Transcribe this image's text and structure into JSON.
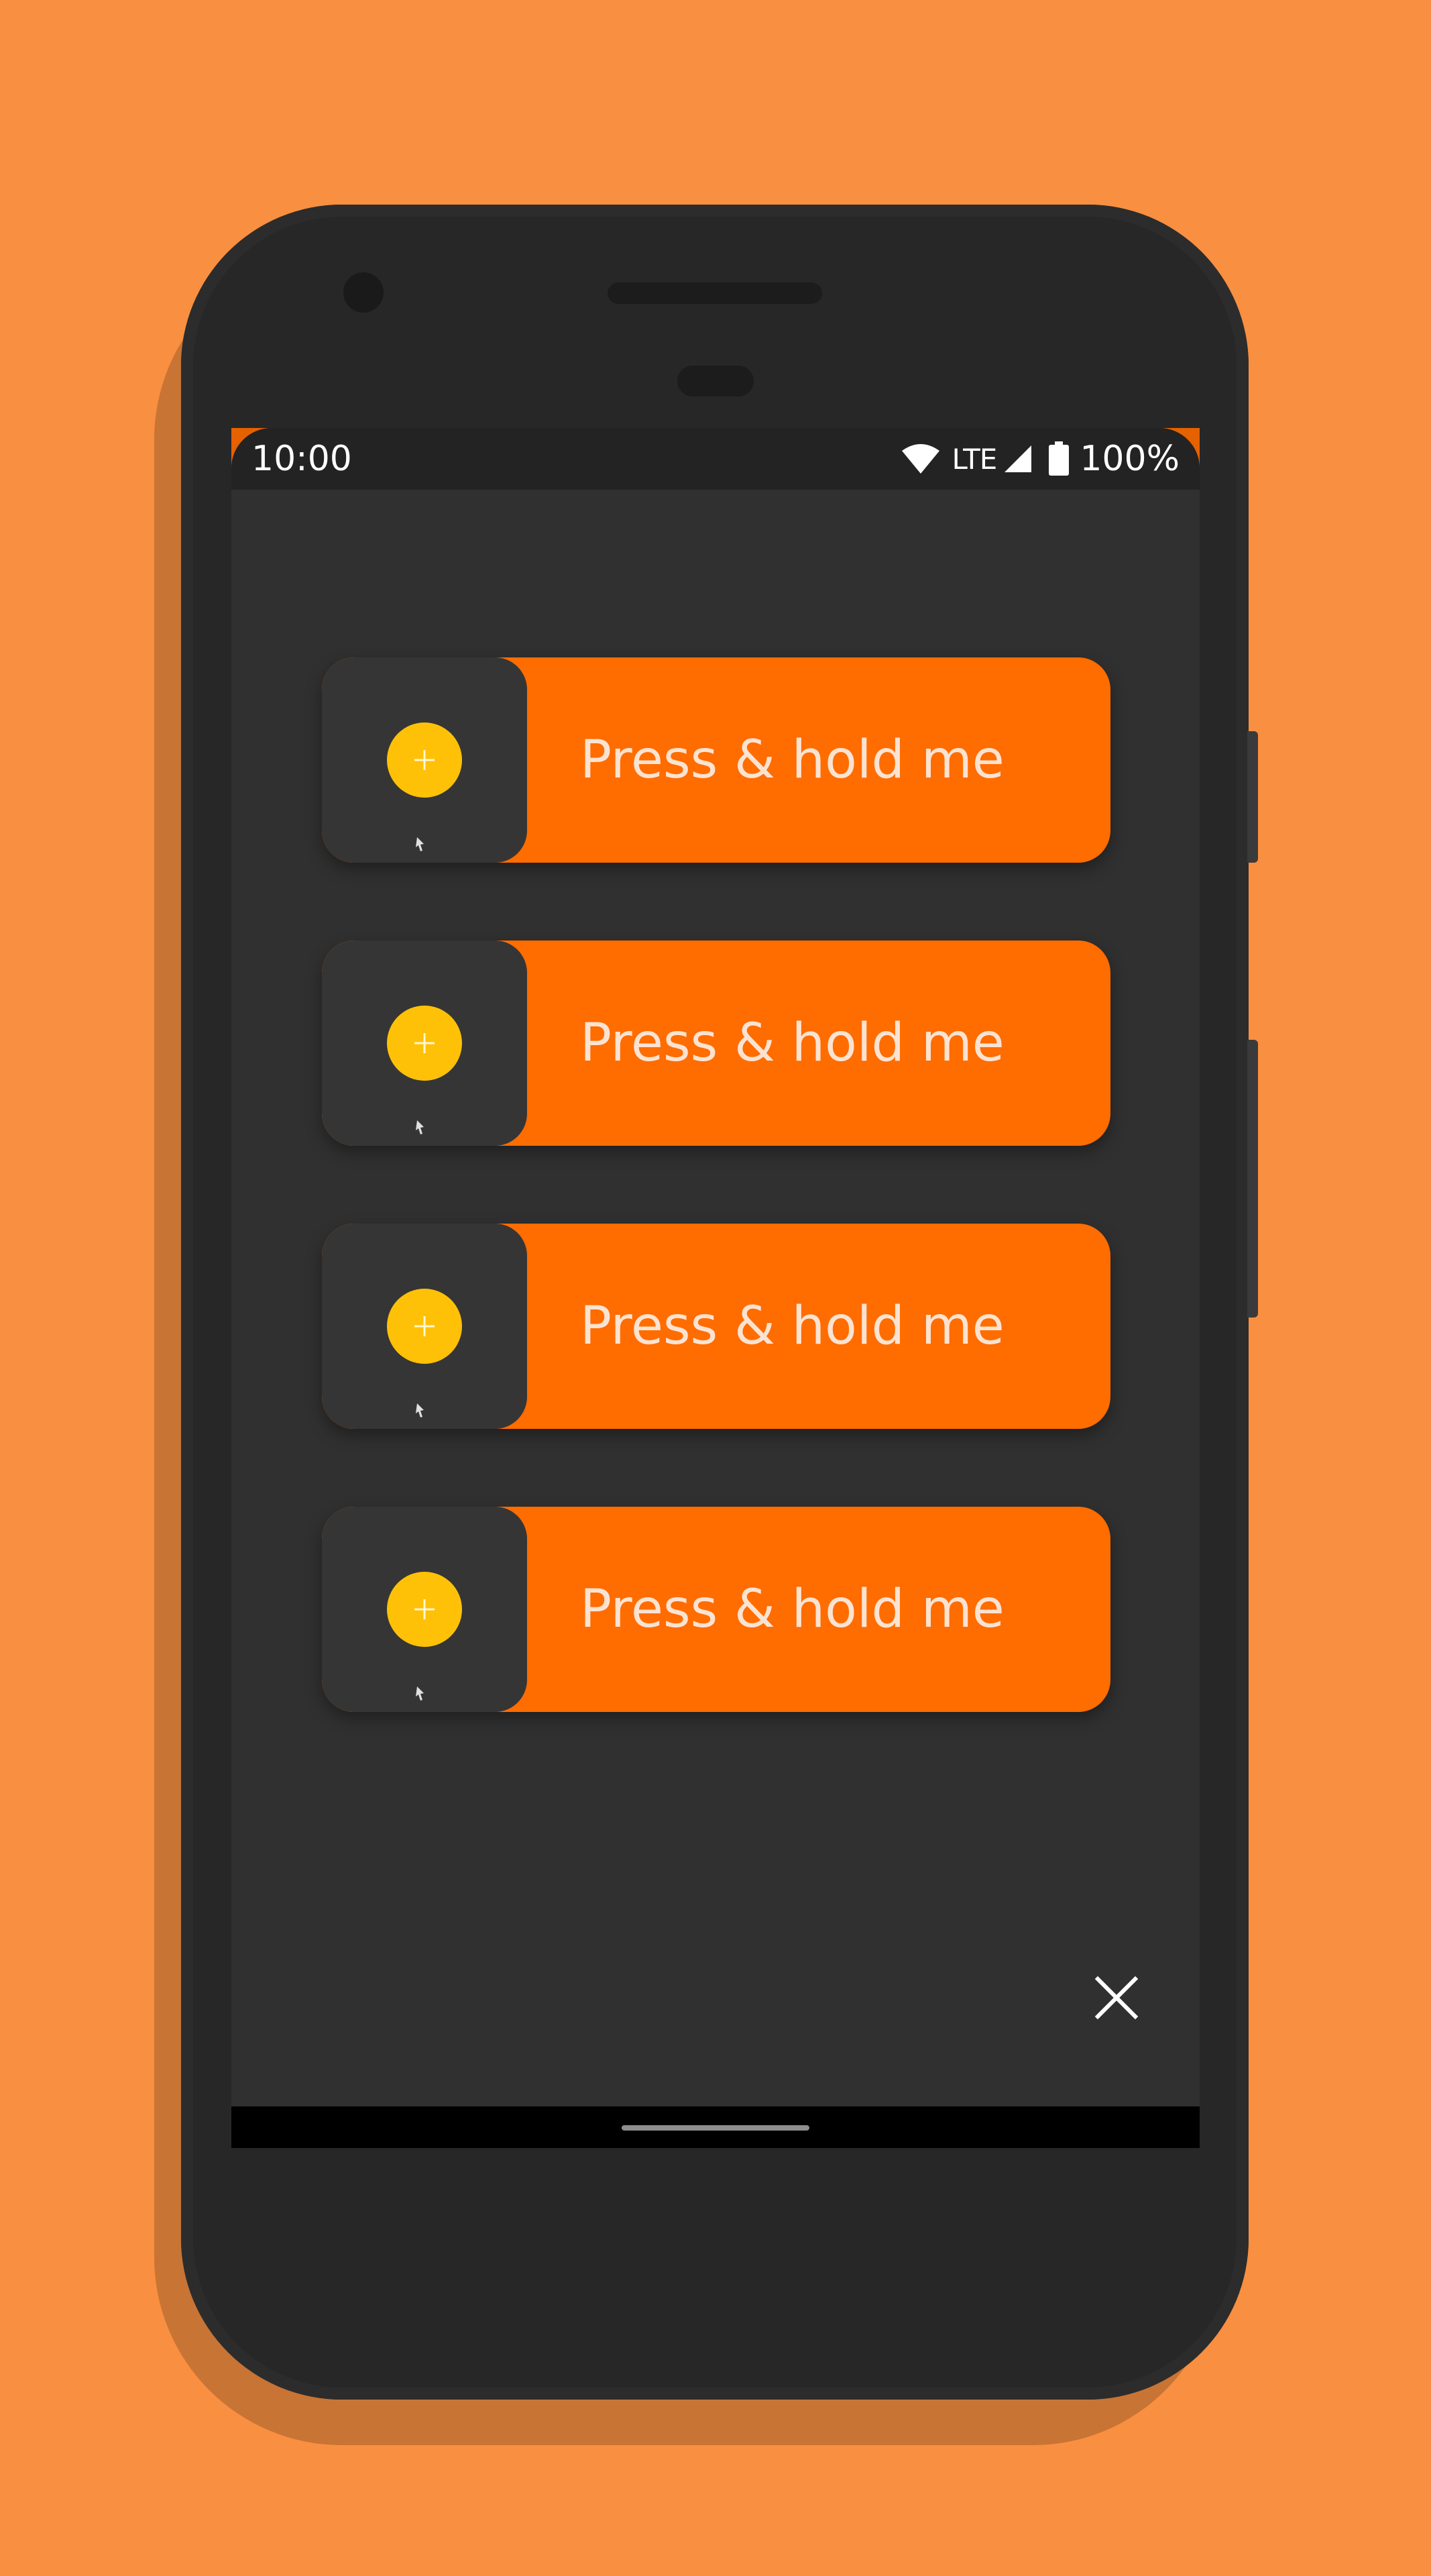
{
  "status_bar": {
    "time": "10:00",
    "network": "LTE",
    "battery": "100%"
  },
  "cards": [
    {
      "label": "Press & hold me",
      "icon": "plus-icon"
    },
    {
      "label": "Press & hold me",
      "icon": "plus-icon"
    },
    {
      "label": "Press & hold me",
      "icon": "plus-icon"
    },
    {
      "label": "Press & hold me",
      "icon": "plus-icon"
    }
  ],
  "close_icon": "close-icon",
  "colors": {
    "background": "#F98F40",
    "accent": "#FF6C00",
    "badge": "#FFC107",
    "surface": "#303030"
  }
}
